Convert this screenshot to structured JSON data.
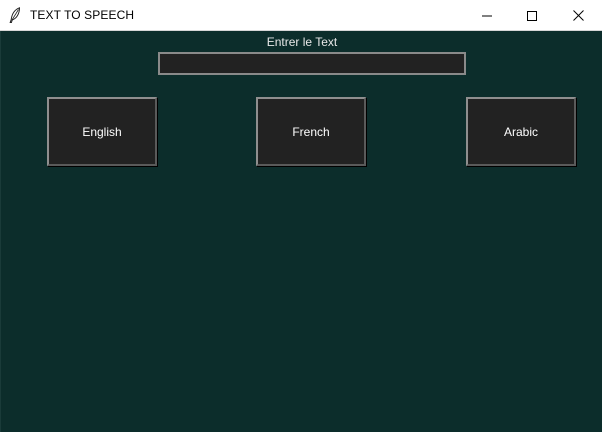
{
  "window": {
    "title": "TEXT TO SPEECH",
    "icon": "feather-icon",
    "controls": [
      "minimize-icon",
      "maximize-icon",
      "close-icon"
    ]
  },
  "main": {
    "prompt_label": "Entrer le Text",
    "text_input_value": "",
    "buttons": {
      "english": "English",
      "french": "French",
      "arabic": "Arabic"
    }
  },
  "colors": {
    "background": "#0c2d2b",
    "button_bg": "#222222",
    "text": "#ffffff"
  }
}
